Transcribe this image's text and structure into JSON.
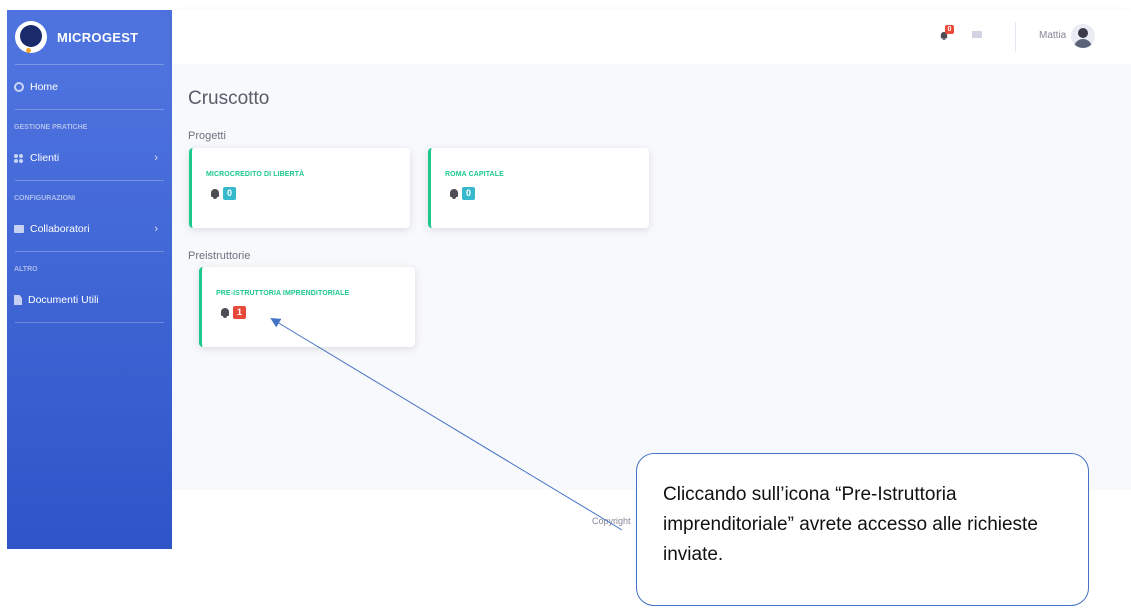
{
  "app": {
    "brand": "MICROGEST"
  },
  "sidebar": {
    "home": "Home",
    "sections": [
      {
        "title": "GESTIONE PRATICHE",
        "items": [
          {
            "label": "Clienti",
            "icon": "users-icon",
            "chevron": "›"
          }
        ]
      },
      {
        "title": "CONFIGURAZIONI",
        "items": [
          {
            "label": "Collaboratori",
            "icon": "folder-icon",
            "chevron": "›"
          }
        ]
      },
      {
        "title": "ALTRO",
        "items": [
          {
            "label": "Documenti Utili",
            "icon": "file-icon"
          }
        ]
      }
    ]
  },
  "topbar": {
    "notification_count": "0",
    "username": "Mattia"
  },
  "main": {
    "title": "Cruscotto",
    "groups": [
      {
        "title": "Progetti",
        "cards": [
          {
            "title": "MICROCREDITO DI LIBERTÀ",
            "count": "0",
            "badge_color": "#36b9cc"
          },
          {
            "title": "ROMA CAPITALE",
            "count": "0",
            "badge_color": "#36b9cc"
          }
        ]
      },
      {
        "title": "Preistruttorie",
        "cards": [
          {
            "title": "PRE-ISTRUTTORIA IMPRENDITORIALE",
            "count": "1",
            "badge_color": "#e74a3b"
          }
        ]
      }
    ]
  },
  "footer": {
    "text": "Copyright"
  },
  "annotation": {
    "text": "Cliccando sull’icona “Pre-Istruttoria imprenditoriale” avrete accesso alle richieste inviate."
  },
  "colors": {
    "sidebar": "#4e73df",
    "card_accent": "#1cc88a",
    "badge_info": "#36b9cc",
    "badge_danger": "#e74a3b",
    "callout_border": "#4472c4"
  }
}
